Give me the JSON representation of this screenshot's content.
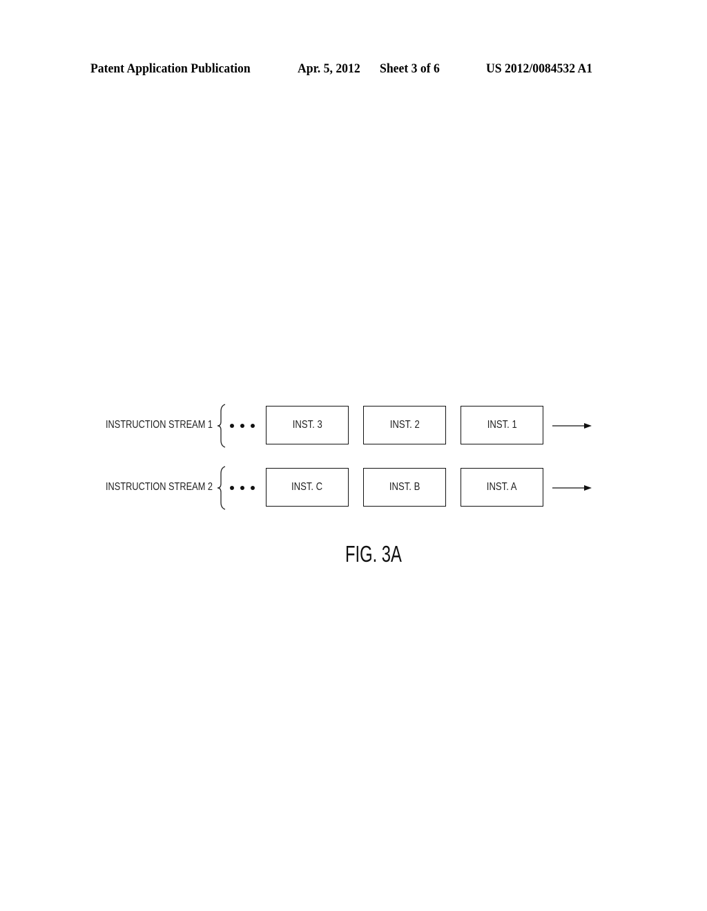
{
  "header": {
    "publication": "Patent Application Publication",
    "date": "Apr. 5, 2012",
    "sheet": "Sheet 3 of 6",
    "number": "US 2012/0084532 A1"
  },
  "figure": {
    "label": "FIG. 3A",
    "streams": [
      {
        "label": "INSTRUCTION STREAM 1",
        "instructions": [
          "INST. 3",
          "INST. 2",
          "INST. 1"
        ]
      },
      {
        "label": "INSTRUCTION STREAM 2",
        "instructions": [
          "INST. C",
          "INST. B",
          "INST. A"
        ]
      }
    ]
  }
}
